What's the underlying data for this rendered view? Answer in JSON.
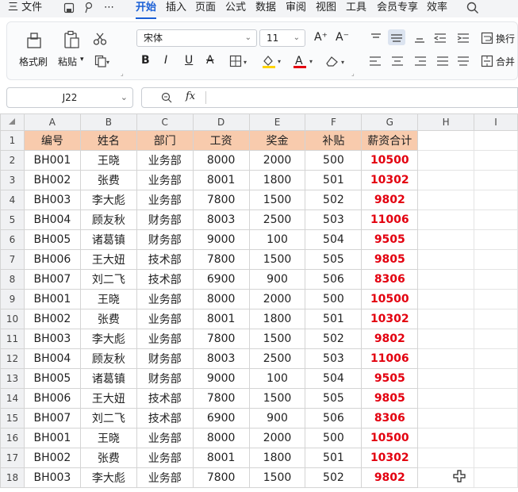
{
  "menu": {
    "items": [
      "三 文件",
      "开始",
      "插入",
      "页面",
      "公式",
      "数据",
      "审阅",
      "视图",
      "工具",
      "会员专享",
      "效率"
    ],
    "active": "开始"
  },
  "ribbon": {
    "format_painter": "格式刷",
    "paste": "粘贴",
    "font_name": "宋体",
    "font_size": "11",
    "wrap": "换行",
    "merge": "合并",
    "font_color": "#e3000f",
    "highlight_color": "#ffd400"
  },
  "formula_bar": {
    "name_box": "J22",
    "fx": "fx",
    "value": ""
  },
  "sheet": {
    "columns": [
      "A",
      "B",
      "C",
      "D",
      "E",
      "F",
      "G",
      "H",
      "I"
    ],
    "header": [
      "编号",
      "姓名",
      "部门",
      "工资",
      "奖金",
      "补贴",
      "薪资合计"
    ],
    "rows": [
      [
        "BH001",
        "王晓",
        "业务部",
        "8000",
        "2000",
        "500",
        "10500"
      ],
      [
        "BH002",
        "张费",
        "业务部",
        "8001",
        "1800",
        "501",
        "10302"
      ],
      [
        "BH003",
        "李大彪",
        "业务部",
        "7800",
        "1500",
        "502",
        "9802"
      ],
      [
        "BH004",
        "顾友秋",
        "财务部",
        "8003",
        "2500",
        "503",
        "11006"
      ],
      [
        "BH005",
        "诸葛镇",
        "财务部",
        "9000",
        "100",
        "504",
        "9505"
      ],
      [
        "BH006",
        "王大妞",
        "技术部",
        "7800",
        "1500",
        "505",
        "9805"
      ],
      [
        "BH007",
        "刘二飞",
        "技术部",
        "6900",
        "900",
        "506",
        "8306"
      ],
      [
        "BH001",
        "王晓",
        "业务部",
        "8000",
        "2000",
        "500",
        "10500"
      ],
      [
        "BH002",
        "张费",
        "业务部",
        "8001",
        "1800",
        "501",
        "10302"
      ],
      [
        "BH003",
        "李大彪",
        "业务部",
        "7800",
        "1500",
        "502",
        "9802"
      ],
      [
        "BH004",
        "顾友秋",
        "财务部",
        "8003",
        "2500",
        "503",
        "11006"
      ],
      [
        "BH005",
        "诸葛镇",
        "财务部",
        "9000",
        "100",
        "504",
        "9505"
      ],
      [
        "BH006",
        "王大妞",
        "技术部",
        "7800",
        "1500",
        "505",
        "9805"
      ],
      [
        "BH007",
        "刘二飞",
        "技术部",
        "6900",
        "900",
        "506",
        "8306"
      ],
      [
        "BH001",
        "王晓",
        "业务部",
        "8000",
        "2000",
        "500",
        "10500"
      ],
      [
        "BH002",
        "张费",
        "业务部",
        "8001",
        "1800",
        "501",
        "10302"
      ],
      [
        "BH003",
        "李大彪",
        "业务部",
        "7800",
        "1500",
        "502",
        "9802"
      ]
    ],
    "header_fill": "#f8cbad",
    "total_color": "#e3000f"
  }
}
